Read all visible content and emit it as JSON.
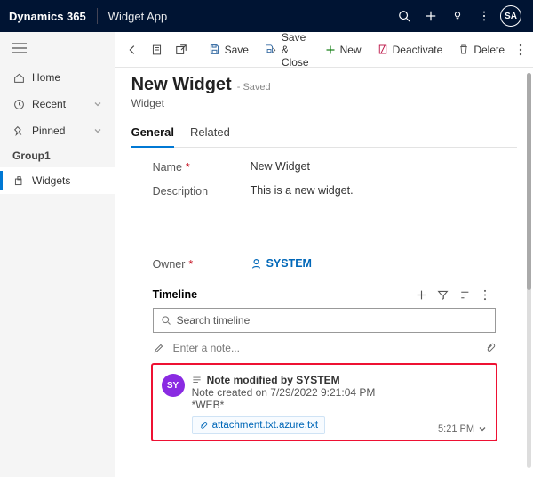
{
  "topbar": {
    "brand": "Dynamics 365",
    "app": "Widget App",
    "avatar": "SA"
  },
  "sidebar": {
    "home": "Home",
    "recent": "Recent",
    "pinned": "Pinned",
    "group": "Group1",
    "widgets": "Widgets"
  },
  "cmd": {
    "save": "Save",
    "save_close": "Save & Close",
    "new": "New",
    "deactivate": "Deactivate",
    "delete": "Delete"
  },
  "record": {
    "title": "New Widget",
    "status": "- Saved",
    "entity": "Widget"
  },
  "tabs": {
    "general": "General",
    "related": "Related"
  },
  "form": {
    "name_label": "Name",
    "name_value": "New Widget",
    "desc_label": "Description",
    "desc_value": "This is a new widget.",
    "owner_label": "Owner",
    "owner_value": "SYSTEM"
  },
  "timeline": {
    "header": "Timeline",
    "search_placeholder": "Search timeline",
    "note_placeholder": "Enter a note..."
  },
  "note": {
    "avatar": "SY",
    "title": "Note modified by SYSTEM",
    "created": "Note created on 7/29/2022 9:21:04 PM",
    "source": "*WEB*",
    "attachment": "attachment.txt.azure.txt",
    "time": "5:21 PM"
  }
}
